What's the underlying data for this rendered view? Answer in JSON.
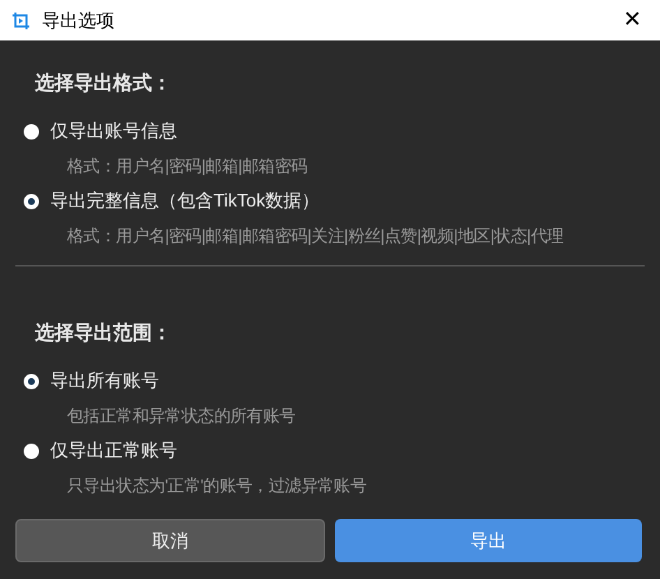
{
  "window": {
    "title": "导出选项",
    "close": "✕"
  },
  "sections": [
    {
      "heading": "选择导出格式：",
      "options": [
        {
          "label": "仅导出账号信息",
          "description": "格式：用户名|密码|邮箱|邮箱密码",
          "selected": false
        },
        {
          "label": "导出完整信息（包含TikTok数据）",
          "description": "格式：用户名|密码|邮箱|邮箱密码|关注|粉丝|点赞|视频|地区|状态|代理",
          "selected": true
        }
      ]
    },
    {
      "heading": "选择导出范围：",
      "options": [
        {
          "label": "导出所有账号",
          "description": "包括正常和异常状态的所有账号",
          "selected": true
        },
        {
          "label": "仅导出正常账号",
          "description": "只导出状态为'正常'的账号，过滤异常账号",
          "selected": false
        }
      ]
    }
  ],
  "buttons": [
    {
      "label": "取消",
      "kind": "secondary"
    },
    {
      "label": "导出",
      "kind": "primary"
    }
  ]
}
